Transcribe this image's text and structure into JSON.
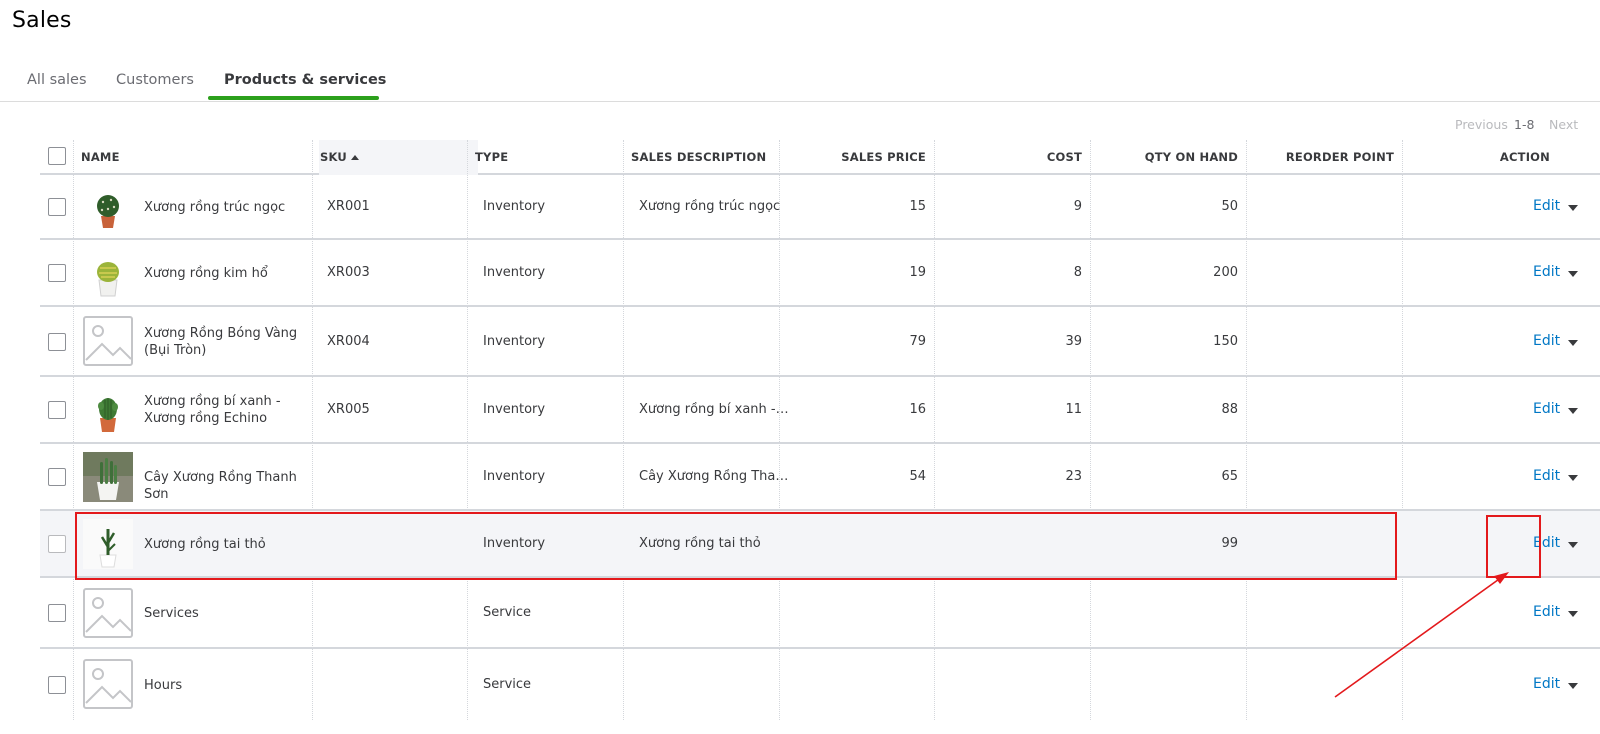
{
  "page": {
    "title": "Sales"
  },
  "tabs": [
    {
      "label": "All sales"
    },
    {
      "label": "Customers"
    },
    {
      "label": "Products & services",
      "active": true
    }
  ],
  "pager": {
    "previous": "Previous",
    "range": "1-8",
    "next": "Next"
  },
  "table": {
    "headers": {
      "name": "NAME",
      "sku": "SKU",
      "type": "TYPE",
      "sales_description": "SALES DESCRIPTION",
      "sales_price": "SALES PRICE",
      "cost": "COST",
      "qty_on_hand": "QTY ON HAND",
      "reorder_point": "REORDER POINT",
      "action": "ACTION"
    },
    "sort": {
      "column": "SKU",
      "direction": "ascending"
    },
    "rows": [
      {
        "name": "Xương rồng trúc ngọc",
        "sku": "XR001",
        "type": "Inventory",
        "sales_description": "Xương rồng trúc ngọc",
        "sales_price": "15",
        "cost": "9",
        "qty_on_hand": "50",
        "reorder_point": "",
        "action": "Edit",
        "image": "cactus-round-pot-icon"
      },
      {
        "name": "Xương rồng kim hổ",
        "sku": "XR003",
        "type": "Inventory",
        "sales_description": "",
        "sales_price": "19",
        "cost": "8",
        "qty_on_hand": "200",
        "reorder_point": "",
        "action": "Edit",
        "image": "golden-barrel-cactus-icon"
      },
      {
        "name": "Xương Rồng Bóng Vàng (Bụi Tròn)",
        "sku": "XR004",
        "type": "Inventory",
        "sales_description": "",
        "sales_price": "79",
        "cost": "39",
        "qty_on_hand": "150",
        "reorder_point": "",
        "action": "Edit",
        "image": "image-placeholder-icon"
      },
      {
        "name": "Xương rồng bí xanh - Xương rồng Echino",
        "sku": "XR005",
        "type": "Inventory",
        "sales_description": "Xương rồng bí xanh - Xương rồng Echino",
        "sales_price": "16",
        "cost": "11",
        "qty_on_hand": "88",
        "reorder_point": "",
        "action": "Edit",
        "image": "echinopsis-cactus-icon"
      },
      {
        "name": "Cây Xương Rồng Thanh Sơn",
        "sku": "",
        "type": "Inventory",
        "sales_description": "Cây Xương Rồng Thanh Sơn",
        "sales_price": "54",
        "cost": "23",
        "qty_on_hand": "65",
        "reorder_point": "",
        "action": "Edit",
        "image": "columnar-cactus-pot-icon"
      },
      {
        "name": "Xương rồng tai thỏ",
        "sku": "",
        "type": "Inventory",
        "sales_description": "Xương rồng tai thỏ",
        "sales_price": "",
        "cost": "",
        "qty_on_hand": "99",
        "reorder_point": "",
        "action": "Edit",
        "image": "bunny-ear-cactus-icon",
        "highlighted": true
      },
      {
        "name": "Services",
        "sku": "",
        "type": "Service",
        "sales_description": "",
        "sales_price": "",
        "cost": "",
        "qty_on_hand": "",
        "reorder_point": "",
        "action": "Edit",
        "image": "image-placeholder-icon"
      },
      {
        "name": "Hours",
        "sku": "",
        "type": "Service",
        "sales_description": "",
        "sales_price": "",
        "cost": "",
        "qty_on_hand": "",
        "reorder_point": "",
        "action": "Edit",
        "image": "image-placeholder-icon"
      }
    ]
  },
  "annotations": {
    "highlight_color": "#e3191c",
    "marks": [
      "highlighted-row-box",
      "edit-button-box",
      "pointer-arrow"
    ]
  },
  "colors": {
    "accent_green": "#2ca01c",
    "link_blue": "#0077c5",
    "text": "#393a3d",
    "muted": "#6b6c72",
    "row_highlight": "#f4f5f8"
  }
}
